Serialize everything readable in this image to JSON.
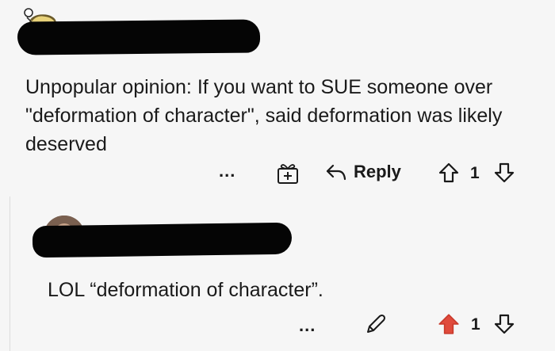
{
  "comment": {
    "author": "",
    "text": "Unpopular opinion: If you want to SUE someone over \"deformation of character\", said deformation was likely deserved",
    "actions": {
      "more": "...",
      "reply_label": "Reply",
      "vote_count": "1"
    }
  },
  "reply": {
    "author": "",
    "text": "LOL “deformation of character”.",
    "actions": {
      "more": "...",
      "vote_count": "1",
      "upvoted": true,
      "upvote_color": "#e04b3c"
    }
  },
  "icons": {
    "award": "gift-icon",
    "reply": "reply-arrow-icon",
    "upvote": "arrow-up-icon",
    "downvote": "arrow-down-icon",
    "edit": "pencil-icon"
  }
}
